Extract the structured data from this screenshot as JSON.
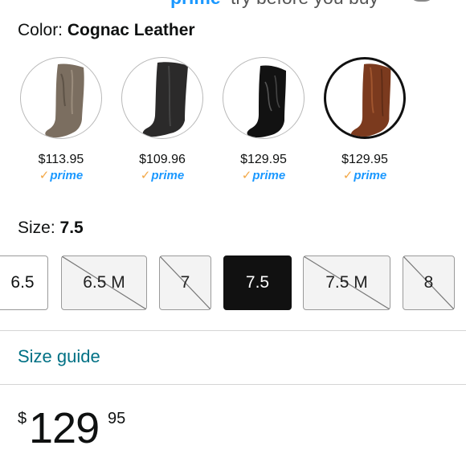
{
  "banner": {
    "prime_text": "prime",
    "try_before_text": "try before you buy"
  },
  "color": {
    "label": "Color:",
    "value": "Cognac Leather"
  },
  "swatches": [
    {
      "price": "$113.95",
      "prime": "prime",
      "selected": false,
      "boot_color": "#7b6e60"
    },
    {
      "price": "$109.96",
      "prime": "prime",
      "selected": false,
      "boot_color": "#2b2a2a"
    },
    {
      "price": "$129.95",
      "prime": "prime",
      "selected": false,
      "boot_color": "#121212"
    },
    {
      "price": "$129.95",
      "prime": "prime",
      "selected": true,
      "boot_color": "#7b3a1e"
    }
  ],
  "size": {
    "label": "Size:",
    "value": "7.5"
  },
  "sizes": [
    {
      "label": "6.5",
      "state": "available"
    },
    {
      "label": "6.5 M",
      "state": "unavailable"
    },
    {
      "label": "7",
      "state": "unavailable"
    },
    {
      "label": "7.5",
      "state": "selected"
    },
    {
      "label": "7.5 M",
      "state": "unavailable"
    },
    {
      "label": "8",
      "state": "unavailable"
    }
  ],
  "size_guide": {
    "label": "Size guide"
  },
  "price": {
    "symbol": "$",
    "whole": "129",
    "fraction": "95"
  },
  "colors": {
    "prime_blue": "#1a98ff",
    "prime_check": "#f3a847",
    "link_teal": "#007185",
    "selected_black": "#111111"
  }
}
